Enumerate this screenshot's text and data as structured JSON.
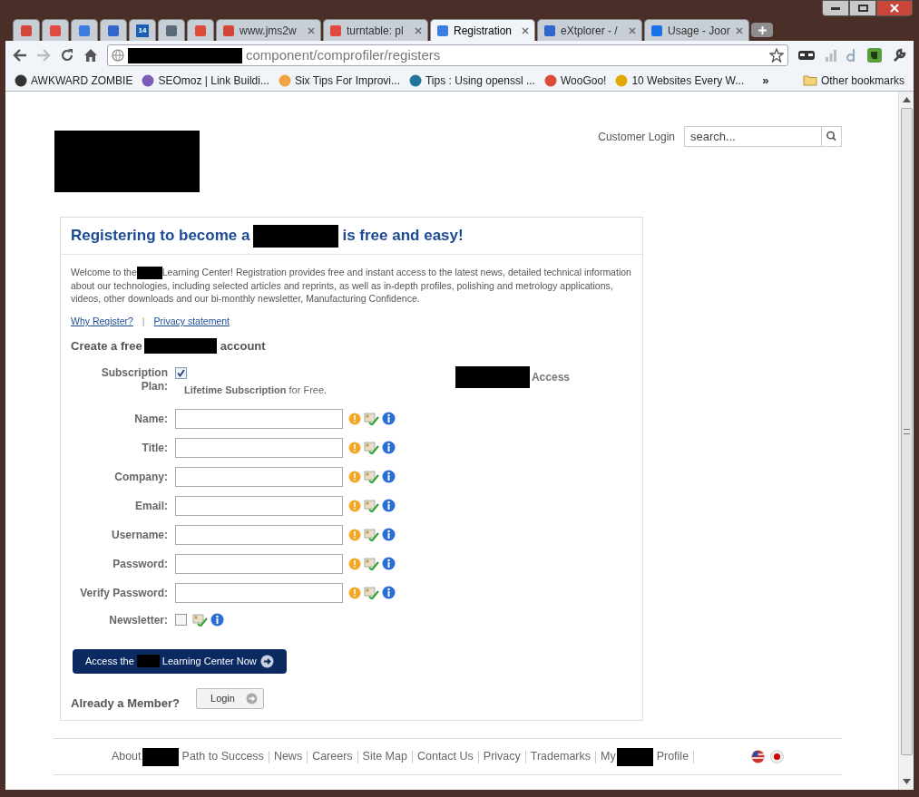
{
  "browser": {
    "tabs": [
      {
        "kind": "pinned",
        "selected": false
      },
      {
        "kind": "pinned",
        "selected": false
      },
      {
        "kind": "pinned",
        "selected": false
      },
      {
        "kind": "pinned",
        "selected": false
      },
      {
        "kind": "pinned",
        "label": "14",
        "selected": false
      },
      {
        "kind": "pinned",
        "selected": false
      },
      {
        "kind": "pinned",
        "selected": false
      },
      {
        "kind": "normal",
        "label": "www.jms2w",
        "selected": false
      },
      {
        "kind": "normal",
        "label": "turntable: pl",
        "selected": false
      },
      {
        "kind": "normal",
        "label": "Registration",
        "selected": true
      },
      {
        "kind": "normal",
        "label": "eXtplorer - /",
        "selected": false
      },
      {
        "kind": "normal",
        "label": "Usage - Joor",
        "selected": false
      }
    ],
    "address": "component/comprofiler/registers",
    "bookmarks": [
      "AWKWARD ZOMBIE",
      "SEOmoz | Link Buildi...",
      "Six Tips For Improvi...",
      "Tips : Using openssl ...",
      "WooGoo!",
      "10 Websites Every W..."
    ],
    "more_bookmarks": "»",
    "other_bookmarks": "Other bookmarks"
  },
  "header": {
    "customer_login": "Customer Login",
    "search_placeholder": "search..."
  },
  "card": {
    "title_before": "Registering to become a",
    "title_after": "is free and easy!",
    "intro_before": "Welcome to the",
    "intro_after": "Learning Center! Registration provides free and instant access to the latest news, detailed technical information about our technologies, including selected articles and reprints, as well as in-depth profiles, polishing and metrology applications, videos, other downloads and our bi-monthly newsletter, Manufacturing Confidence.",
    "links": [
      "Why Register?",
      "Privacy statement"
    ],
    "link_separator": "|",
    "create_before": "Create a free",
    "create_after": "account",
    "subscription": {
      "label": "Subscription Plan:",
      "checked": true,
      "plan": "**Lifetime Subscription** for Free.",
      "access": "Access"
    },
    "fields": [
      {
        "kind": "text",
        "label": "Name:",
        "required": true
      },
      {
        "kind": "text",
        "label": "Title:",
        "required": true
      },
      {
        "kind": "text",
        "label": "Company:",
        "required": true
      },
      {
        "kind": "text",
        "label": "Email:",
        "required": true
      },
      {
        "kind": "text",
        "label": "Username:",
        "required": true
      },
      {
        "kind": "text",
        "label": "Password:",
        "required": true
      },
      {
        "kind": "text",
        "label": "Verify Password:",
        "required": true
      },
      {
        "kind": "checkbox",
        "label": "Newsletter:",
        "required": false,
        "checked": false
      }
    ],
    "submit_before": "Access the",
    "submit_after": "Learning Center Now",
    "member_prompt": "Already a Member?",
    "login": "Login"
  },
  "footer": {
    "links": [
      {
        "before": "About",
        "redacted": true,
        "after": "Path to Success"
      },
      {
        "before": "News",
        "redacted": false
      },
      {
        "before": "Careers",
        "redacted": false
      },
      {
        "before": "Site Map",
        "redacted": false
      },
      {
        "before": "Contact Us",
        "redacted": false
      },
      {
        "before": "Privacy",
        "redacted": false
      },
      {
        "before": "Trademarks",
        "redacted": false
      },
      {
        "before": "My",
        "redacted": true,
        "after": "Profile"
      }
    ]
  }
}
